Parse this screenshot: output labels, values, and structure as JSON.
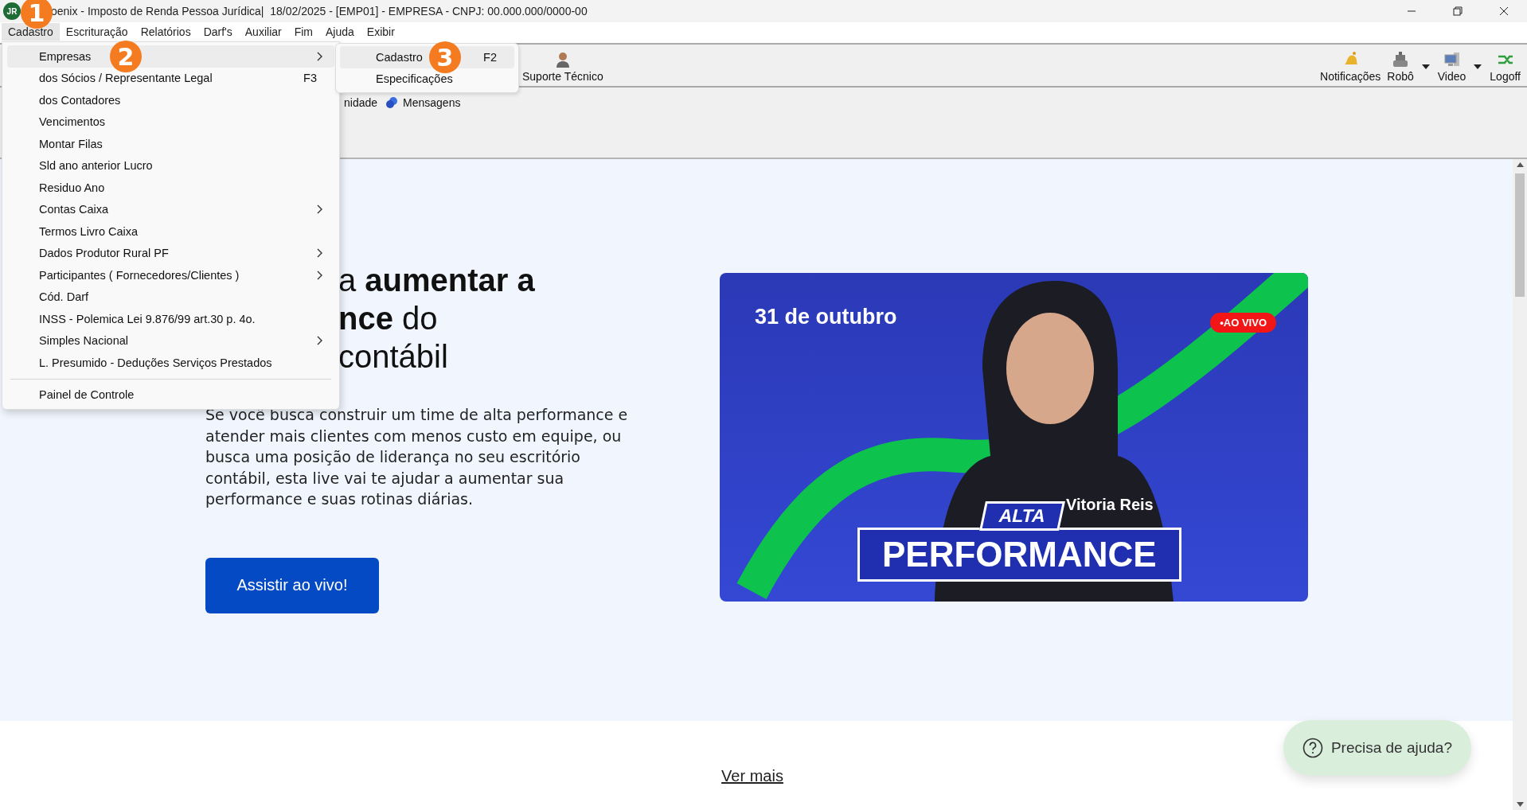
{
  "window": {
    "logo": "JR",
    "title": "oenix - Imposto de Renda Pessoa Jurídica|  18/02/2025 - [EMP01] - EMPRESA - CNPJ: 00.000.000/0000-00",
    "marker": "1"
  },
  "menu_bar": [
    {
      "label": "Cadastro",
      "selected": true
    },
    {
      "label": "Escrituração",
      "selected": false
    },
    {
      "label": "Relatórios",
      "selected": false
    },
    {
      "label": "Darf's",
      "selected": false
    },
    {
      "label": "Auxiliar",
      "selected": false
    },
    {
      "label": "Fim",
      "selected": false
    },
    {
      "label": "Ajuda",
      "selected": false
    },
    {
      "label": "Exibir",
      "selected": false
    }
  ],
  "menu": {
    "items": [
      {
        "kind": "submenu",
        "label": "Empresas",
        "selected": true,
        "marker": "2"
      },
      {
        "kind": "item",
        "label": "dos Sócios / Representante Legal",
        "shortcut": "F3",
        "selected": false
      },
      {
        "kind": "item",
        "label": "dos Contadores",
        "selected": false
      },
      {
        "kind": "item",
        "label": "Vencimentos",
        "selected": false
      },
      {
        "kind": "item",
        "label": "Montar Filas",
        "selected": false
      },
      {
        "kind": "item",
        "label": "Sld ano anterior Lucro",
        "selected": false
      },
      {
        "kind": "item",
        "label": "Residuo Ano",
        "selected": false
      },
      {
        "kind": "submenu",
        "label": "Contas Caixa",
        "selected": false
      },
      {
        "kind": "item",
        "label": "Termos Livro Caixa",
        "selected": false
      },
      {
        "kind": "submenu",
        "label": "Dados Produtor Rural PF",
        "selected": false
      },
      {
        "kind": "submenu",
        "label": "Participantes ( Fornecedores/Clientes )",
        "selected": false
      },
      {
        "kind": "item",
        "label": "Cód. Darf",
        "selected": false
      },
      {
        "kind": "item",
        "label": "INSS - Polemica Lei 9.876/99 art.30  p. 4o.",
        "selected": false
      },
      {
        "kind": "submenu",
        "label": "Simples Nacional",
        "selected": false
      },
      {
        "kind": "item",
        "label": "L. Presumido - Deduções Serviços Prestados",
        "selected": false
      },
      {
        "kind": "separator"
      },
      {
        "kind": "item",
        "label": "Painel de Controle",
        "selected": false
      }
    ]
  },
  "submenu": {
    "items": [
      {
        "label": "Cadastro",
        "shortcut": "F2",
        "selected": true,
        "marker": "3"
      },
      {
        "label": "Especificações",
        "selected": false
      }
    ]
  },
  "toolbar": {
    "left": [
      {
        "kind": "support",
        "label": "Suporte Técnico",
        "dropdown": false
      }
    ],
    "right": [
      {
        "kind": "bell",
        "label": "Notificações",
        "dropdown": false
      },
      {
        "kind": "robot",
        "label": "Robô",
        "dropdown": true
      },
      {
        "kind": "monitor",
        "label": "Video",
        "dropdown": true
      },
      {
        "kind": "logoff",
        "label": "Logoff",
        "dropdown": false
      }
    ]
  },
  "second_bar": [
    {
      "kind": "text",
      "label": "nidade"
    },
    {
      "kind": "messages",
      "label": "Mensagens"
    }
  ],
  "page": {
    "heading": [
      "a **aumentar a**",
      "**nce** do",
      "contábil"
    ],
    "paragraph": "Se você busca construir um time de alta performance e atender mais clientes com menos custo em equipe, ou busca uma posição de liderança no seu escritório contábil, esta live vai te ajudar a aumentar sua performance e suas rotinas diárias.",
    "button": "Assistir ao vivo!",
    "banner": {
      "date": "31 de outubro",
      "badge": "•AO VIVO",
      "name": "Vitoria Reis",
      "tag": "ALTA",
      "title": "PERFORMANCE"
    },
    "link": "Ver mais",
    "help": "Precisa de ajuda?"
  }
}
